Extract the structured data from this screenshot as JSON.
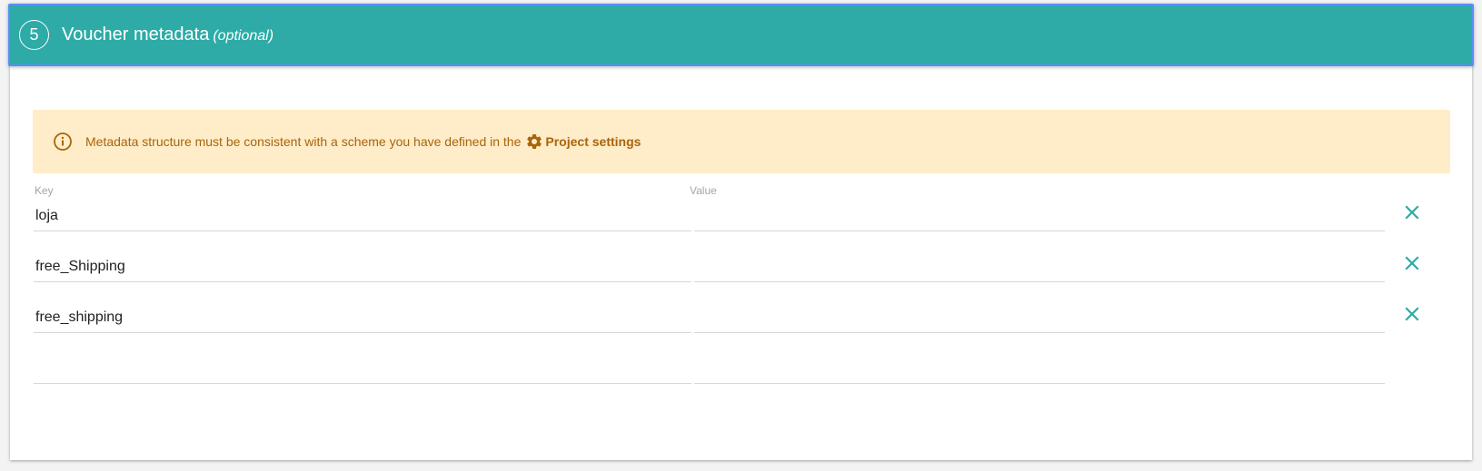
{
  "section": {
    "step_number": "5",
    "title": "Voucher metadata",
    "optional_label": "(optional)"
  },
  "notice": {
    "text": "Metadata structure must be consistent with a scheme you have defined in the",
    "link_label": "Project settings",
    "icon": "info-icon",
    "link_icon": "gear-icon"
  },
  "columns": {
    "key_label": "Key",
    "value_label": "Value"
  },
  "rows": [
    {
      "key": "loja",
      "value": ""
    },
    {
      "key": "free_Shipping",
      "value": ""
    },
    {
      "key": "free_shipping",
      "value": ""
    },
    {
      "key": "",
      "value": ""
    }
  ],
  "colors": {
    "header": "#2eaba6",
    "notice_bg": "#ffecc8",
    "notice_text": "#a8650c",
    "remove_icon": "#2eaba6"
  }
}
